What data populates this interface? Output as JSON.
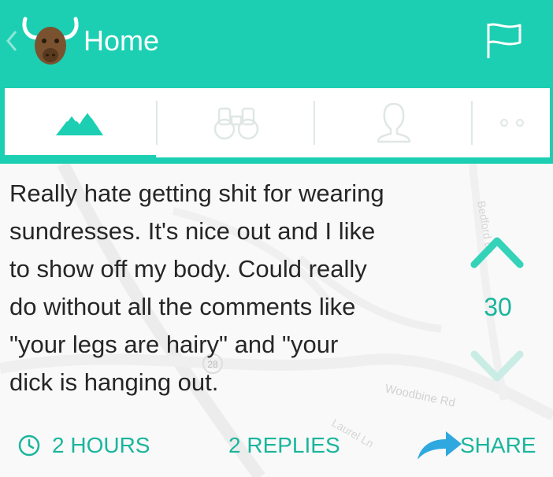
{
  "header": {
    "title": "Home",
    "back_icon": "chevron-left-icon",
    "logo_icon": "yak-icon",
    "flag_icon": "flag-icon"
  },
  "tabs": [
    {
      "name": "mountain-icon",
      "active": true
    },
    {
      "name": "binoculars-icon",
      "active": false
    },
    {
      "name": "profile-icon",
      "active": false
    },
    {
      "name": "more-icon",
      "active": false
    }
  ],
  "post": {
    "text": "Really hate getting shit for wearing\nsundresses. It's nice out and I like\nto show off my body. Could really\ndo without all the comments like\n\"your legs are hairy\" and \"your\ndick is hanging out.",
    "votes": "30",
    "time_label": "2 HOURS",
    "replies_label": "2 REPLIES",
    "share_label": "SHARE"
  },
  "map": {
    "labels": [
      "Woodbine Rd",
      "Laurel Ln",
      "Bedford Dr",
      "28"
    ]
  },
  "colors": {
    "accent": "#1ccfb2",
    "accent_text": "#1ab59d",
    "vote_down": "#c9ece5"
  }
}
